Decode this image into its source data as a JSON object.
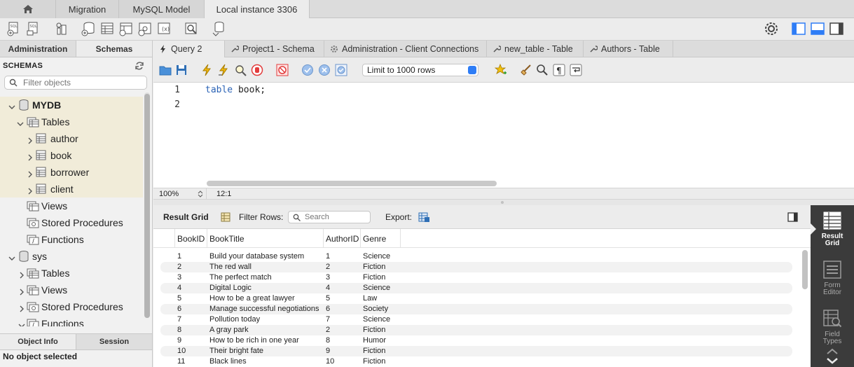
{
  "top_tabs": [
    "Migration",
    "MySQL Model",
    "Local instance 3306"
  ],
  "left_tabs": {
    "administration": "Administration",
    "schemas": "Schemas"
  },
  "schemas_header": "SCHEMAS",
  "filter_placeholder": "Filter objects",
  "tree": {
    "mydb": "MYDB",
    "tables": "Tables",
    "author": "author",
    "book": "book",
    "borrower": "borrower",
    "client": "client",
    "views": "Views",
    "stored_procedures": "Stored Procedures",
    "functions": "Functions",
    "sys": "sys",
    "sys_tables": "Tables",
    "sys_views": "Views",
    "sys_stored_procedures": "Stored Procedures",
    "sys_functions": "Functions"
  },
  "bottom_tabs": {
    "object_info": "Object Info",
    "session": "Session"
  },
  "no_object": "No object selected",
  "editor_tabs": [
    "Query 2",
    "Project1 - Schema",
    "Administration - Client Connections",
    "new_table - Table",
    "Authors - Table"
  ],
  "limit_select": "Limit to 1000 rows",
  "editor": {
    "line_numbers": [
      "1",
      "2"
    ],
    "keyword": "table",
    "rest": " book;"
  },
  "status": {
    "zoom": "100%",
    "cursor": "12:1"
  },
  "result_toolbar": {
    "result_grid": "Result Grid",
    "filter_rows": "Filter Rows:",
    "search_placeholder": "Search",
    "export": "Export:"
  },
  "grid": {
    "columns": [
      "BookID",
      "BookTitle",
      "AuthorID",
      "Genre"
    ],
    "rows": [
      [
        "1",
        "Build your database system",
        "1",
        "Science"
      ],
      [
        "2",
        "The red wall",
        "2",
        "Fiction"
      ],
      [
        "3",
        "The perfect match",
        "3",
        "Fiction"
      ],
      [
        "4",
        "Digital Logic",
        "4",
        "Science"
      ],
      [
        "5",
        "How to be a great lawyer",
        "5",
        "Law"
      ],
      [
        "6",
        "Manage successful negotiations",
        "6",
        "Society"
      ],
      [
        "7",
        "Pollution today",
        "7",
        "Science"
      ],
      [
        "8",
        "A gray park",
        "2",
        "Fiction"
      ],
      [
        "9",
        "How to be rich in one year",
        "8",
        "Humor"
      ],
      [
        "10",
        "Their bright fate",
        "9",
        "Fiction"
      ],
      [
        "11",
        "Black lines",
        "10",
        "Fiction"
      ]
    ]
  },
  "right_panel": {
    "result_grid_1": "Result",
    "result_grid_2": "Grid",
    "form_editor_1": "Form",
    "form_editor_2": "Editor",
    "field_types_1": "Field",
    "field_types_2": "Types"
  },
  "colors": {
    "accent": "#2e7df6",
    "tree_highlight": "#f1ecd9",
    "keyword": "#2b63b6",
    "side_panel": "#3b3b3b"
  }
}
